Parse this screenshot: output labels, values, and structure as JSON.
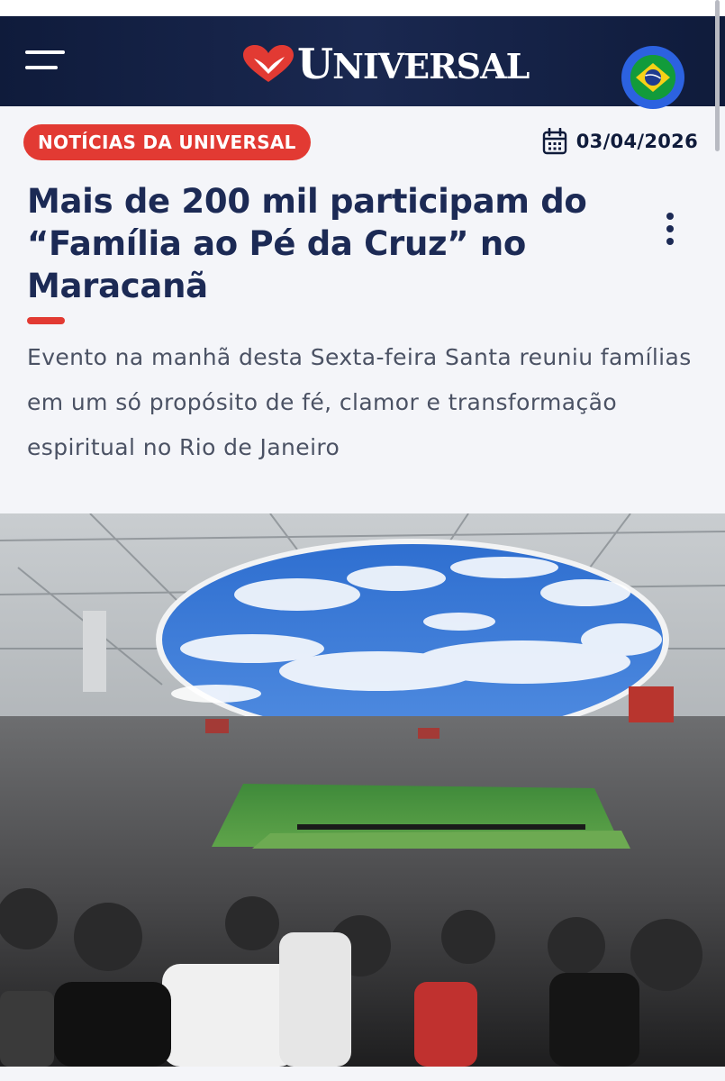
{
  "header": {
    "logo_text_initial": "U",
    "logo_text_rest": "NIVERSAL",
    "menu_icon": "hamburger-menu-icon",
    "language_flag": "brazil-flag-icon"
  },
  "article": {
    "category": "NOTÍCIAS DA UNIVERSAL",
    "date": "03/04/2026",
    "title": "Mais de 200 mil participam do “Família ao Pé da Cruz” no Maracanã",
    "subtitle": "Evento na manhã desta Sexta-feira Santa reuniu famílias em um só propósito de fé, clamor e transformação espiritual no Rio de Janeiro",
    "image_subject": "stadium-crowd-photo"
  },
  "colors": {
    "header_bg": "#1a2850",
    "accent_red": "#e23a33",
    "title_navy": "#1c2a55",
    "subtitle_gray": "#4b5264",
    "flag_ring": "#2c62e0"
  }
}
